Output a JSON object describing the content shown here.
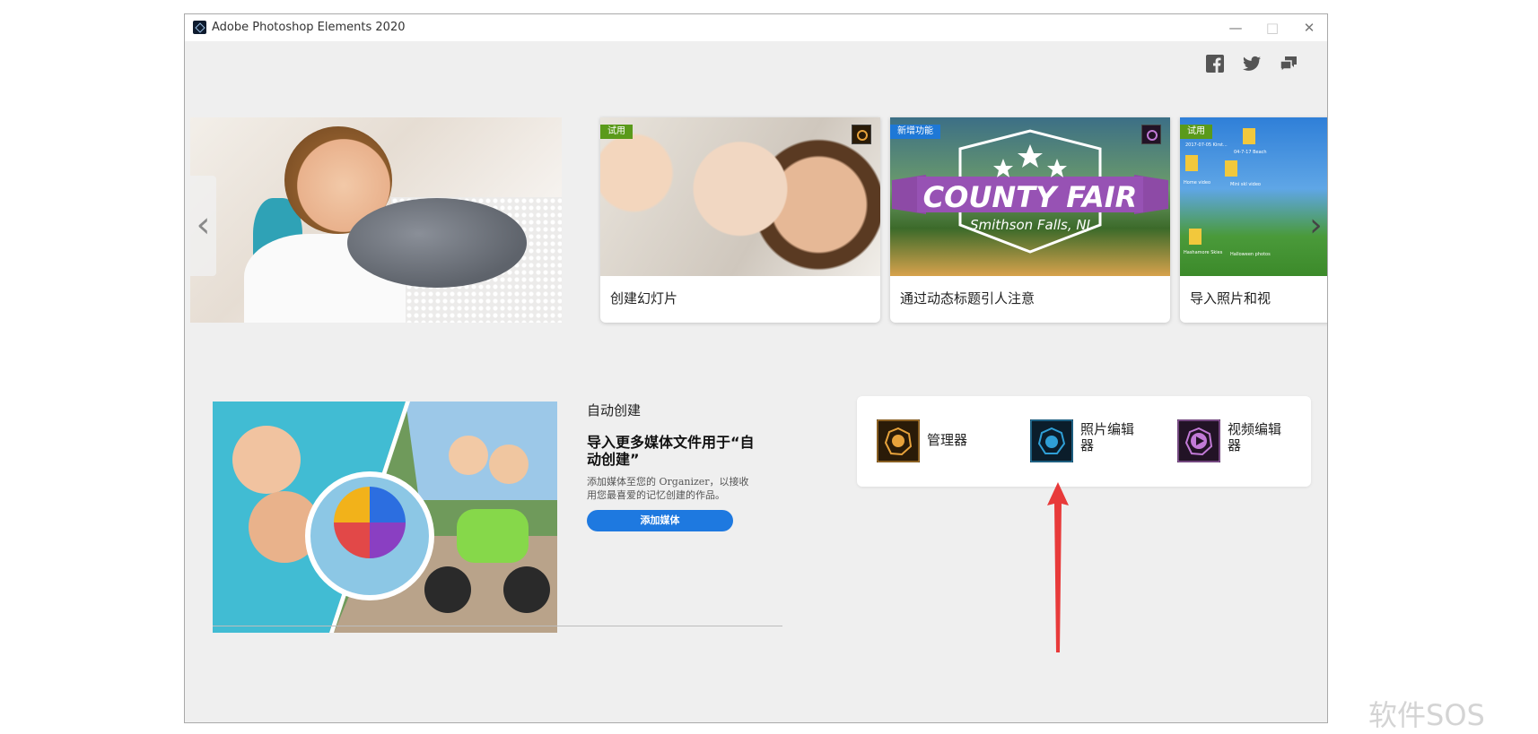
{
  "window": {
    "title": "Adobe Photoshop Elements 2020"
  },
  "window_controls": {
    "minimize": "—",
    "maximize": "□",
    "close": "✕"
  },
  "social": [
    {
      "name": "facebook-icon"
    },
    {
      "name": "twitter-icon"
    },
    {
      "name": "feedback-icon"
    }
  ],
  "carousel": {
    "prev": "‹",
    "next": "›",
    "cards": [
      {
        "label": "创建幻灯片",
        "badge": "试用",
        "badge_color": "#5a9a1a",
        "product": "organizer"
      },
      {
        "label": "通过动态标题引人注意",
        "badge": "新增功能",
        "badge_color": "#1e78d6",
        "product": "premiere-elements",
        "art_title": "COUNTY FAIR",
        "art_subtitle": "Smithson Falls, NJ"
      },
      {
        "label": "导入照片和视",
        "badge": "试用",
        "badge_color": "#5a9a1a",
        "thumb_captions": [
          "2017-07-05 Kirst...",
          "04-7-17 Beach",
          "Home video",
          "Mini skl video",
          "Hashamore Skies",
          "Halloween photos"
        ]
      }
    ]
  },
  "auto_creation": {
    "eyebrow": "自动创建",
    "heading": "导入更多媒体文件用于“自动创建”",
    "description": "添加媒体至您的 Organizer，以接收用您最喜爱的记忆创建的作品。",
    "button": "添加媒体"
  },
  "launchers": [
    {
      "label": "管理器",
      "icon": "organizer-icon",
      "color": "#e7a23b"
    },
    {
      "label": "照片编辑器",
      "icon": "photo-editor-icon",
      "color": "#2f9fd6"
    },
    {
      "label": "视频编辑器",
      "icon": "video-editor-icon",
      "color": "#c17ad6"
    }
  ],
  "annotation": {
    "color": "#e83a3a"
  },
  "watermark": "软件SOS"
}
